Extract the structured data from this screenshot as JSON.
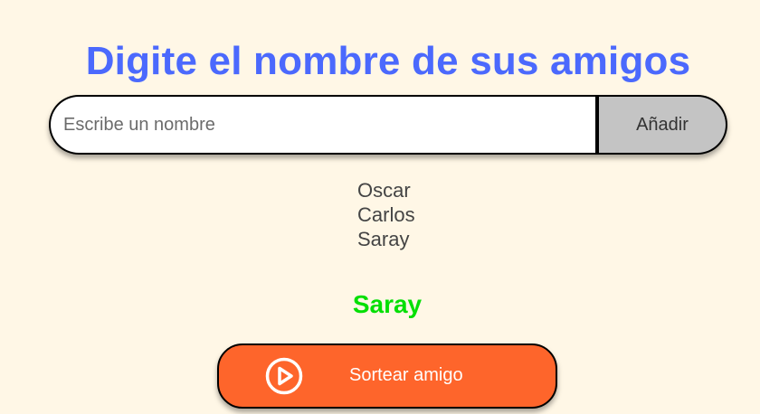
{
  "header": {
    "title": "Digite el nombre de sus amigos"
  },
  "form": {
    "input_placeholder": "Escribe un nombre",
    "input_value": "",
    "add_label": "Añadir"
  },
  "friends": [
    "Oscar",
    "Carlos",
    "Saray"
  ],
  "result": {
    "text": "Saray"
  },
  "draw_button": {
    "label": "Sortear amigo",
    "icon": "play-circle-icon"
  },
  "colors": {
    "background": "#FFF7E6",
    "title": "#4B69FD",
    "result": "#05DF05",
    "draw_button": "#FE652B",
    "add_button": "#C4C4C4"
  }
}
